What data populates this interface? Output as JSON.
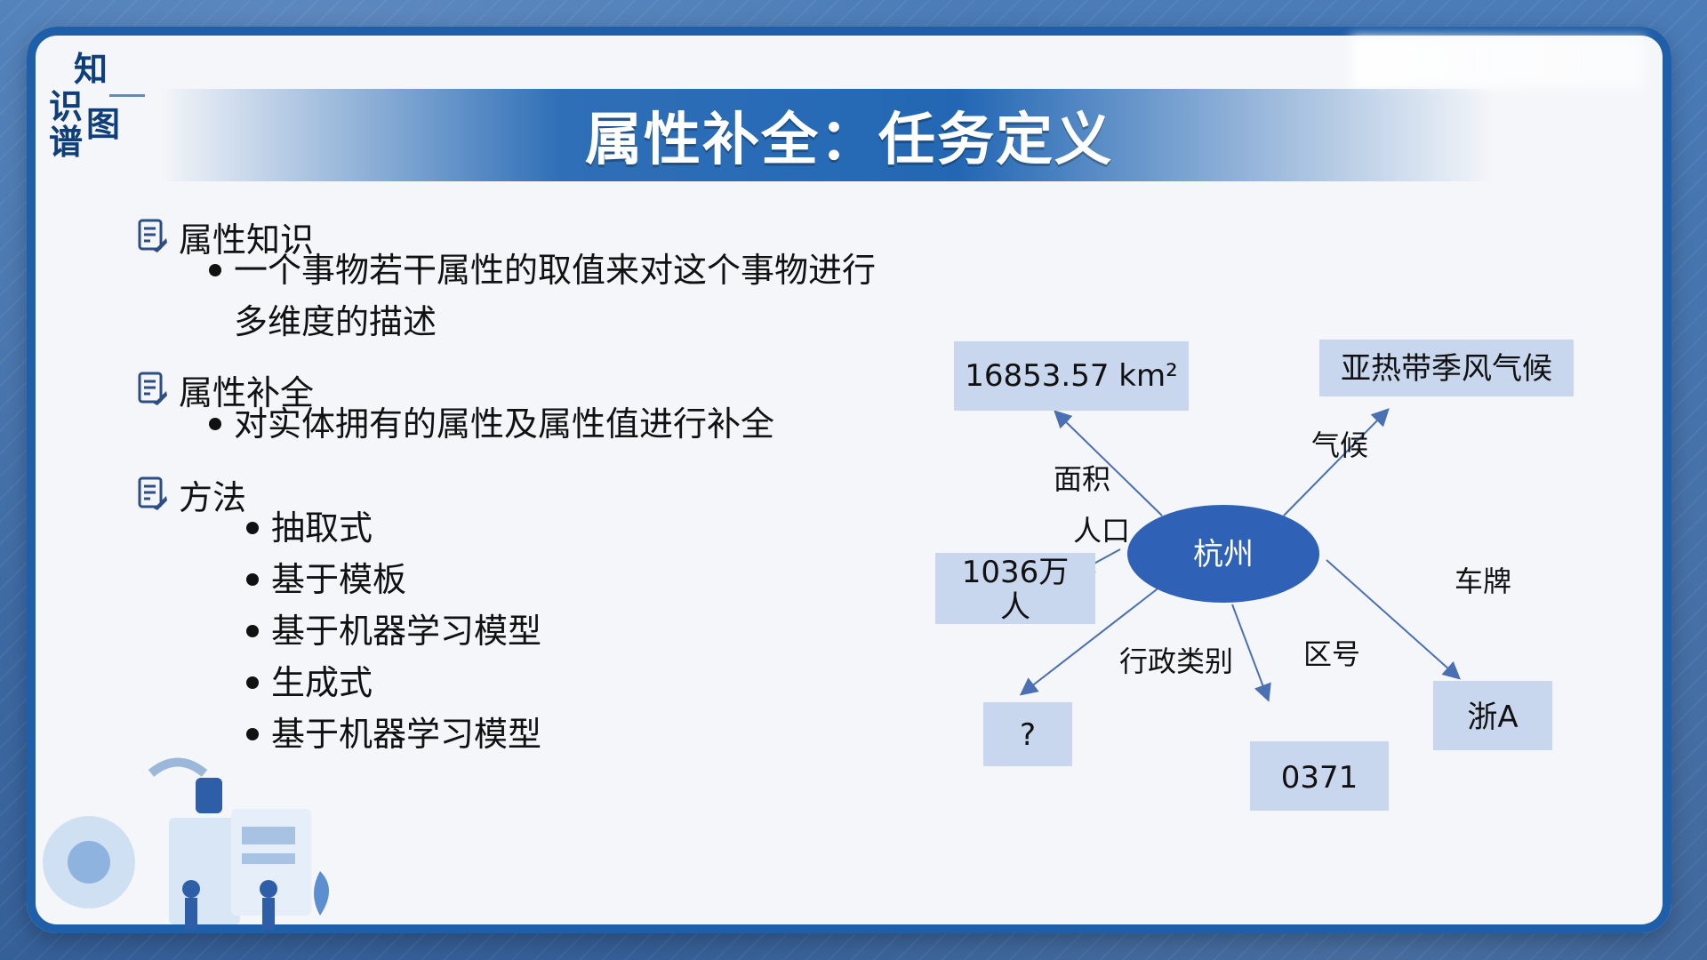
{
  "logo": {
    "line1": "知",
    "line2": "识",
    "line3": "图",
    "line4": "谱"
  },
  "title": "属性补全：任务定义",
  "sections": [
    {
      "heading": "属性知识",
      "bullets": [
        "一个事物若干属性的取值来对这个事物进行",
        "多维度的描述"
      ]
    },
    {
      "heading": "属性补全",
      "bullets": [
        "对实体拥有的属性及属性值进行补全"
      ]
    },
    {
      "heading": "方法",
      "bullets": [
        "抽取式",
        "基于模板",
        "基于机器学习模型",
        "生成式",
        "基于机器学习模型"
      ]
    }
  ],
  "diagram": {
    "center": "杭州",
    "nodes": [
      {
        "id": "area",
        "value": "16853.57 km²",
        "relation": "面积"
      },
      {
        "id": "climate",
        "value": "亚热带季风气候",
        "relation": "气候"
      },
      {
        "id": "population",
        "value_line1": "1036万",
        "value_line2": "人",
        "relation": "人口"
      },
      {
        "id": "admin",
        "value": "?",
        "relation": "行政类别"
      },
      {
        "id": "areacode",
        "value": "0371",
        "relation": "区号"
      },
      {
        "id": "plate",
        "value": "浙A",
        "relation": "车牌"
      }
    ],
    "colors": {
      "ellipse": "#2f62b6",
      "box": "#c8d7ee",
      "line": "#4a6fb2"
    }
  },
  "colors": {
    "title_bg": "#2367b4",
    "frame": "#1f5ea8"
  }
}
